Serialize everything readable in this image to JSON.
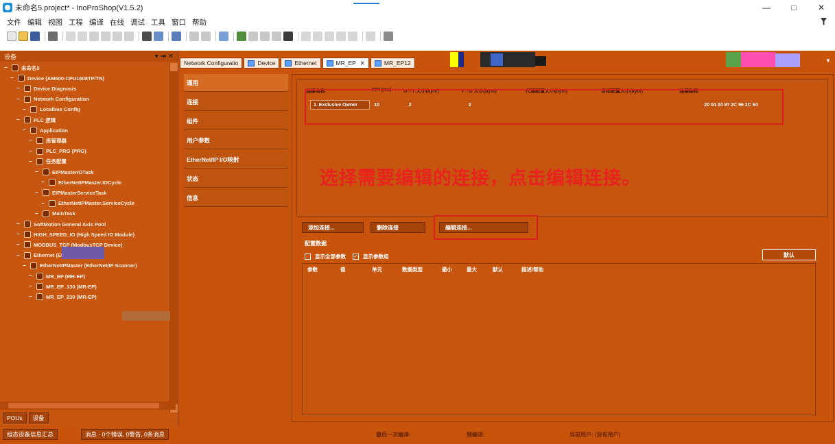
{
  "window": {
    "title": "未命名5.project* - InoProShop(V1.5.2)",
    "controls": [
      "—",
      "□",
      "✕"
    ]
  },
  "menu": [
    "文件",
    "编辑",
    "视图",
    "工程",
    "编译",
    "在线",
    "调试",
    "工具",
    "窗口",
    "帮助"
  ],
  "left_panel": {
    "title": "设备",
    "pin_controls": "▾ ⇥ ✕",
    "tree": [
      {
        "label": "未命名5",
        "indent": 0
      },
      {
        "label": "Device (AM600-CPU1608TP/TN)",
        "indent": 1
      },
      {
        "label": "Device Diagnosis",
        "indent": 2
      },
      {
        "label": "Network Configuration",
        "indent": 2
      },
      {
        "label": "Localbus Config",
        "indent": 3
      },
      {
        "label": "PLC 逻辑",
        "indent": 2
      },
      {
        "label": "Application",
        "indent": 3
      },
      {
        "label": "库管理器",
        "indent": 4
      },
      {
        "label": "PLC_PRG (PRG)",
        "indent": 4
      },
      {
        "label": "任务配置",
        "indent": 4
      },
      {
        "label": "EIPMasterIOTask",
        "indent": 5
      },
      {
        "label": "EtherNetIPMaster.IOCycle",
        "indent": 6
      },
      {
        "label": "EIPMasterServiceTask",
        "indent": 5
      },
      {
        "label": "EtherNetIPMaster.ServiceCycle",
        "indent": 6
      },
      {
        "label": "MainTask",
        "indent": 5
      },
      {
        "label": "SoftMotion General Axis Pool",
        "indent": 2
      },
      {
        "label": "HIGH_SPEED_IO (High Speed IO Module)",
        "indent": 2
      },
      {
        "label": "MODBUS_TCP (ModbusTCP Device)",
        "indent": 2
      },
      {
        "label": "Ethernet (Ethernet)",
        "indent": 2
      },
      {
        "label": "EtherNetIPMaster (EtherNet/IP Scanner)",
        "indent": 3
      },
      {
        "label": "MR_EP (MR-EP)",
        "indent": 4
      },
      {
        "label": "MR_EP_130 (MR-EP)",
        "indent": 4
      },
      {
        "label": "MR_EP_230 (MR-EP)",
        "indent": 4
      }
    ],
    "bottom_tabs": [
      "POUs",
      "设备"
    ]
  },
  "editor_tabs": [
    {
      "label": "Network Configuratio",
      "active": false
    },
    {
      "label": "Device",
      "active": false
    },
    {
      "label": "Ethernet",
      "active": false
    },
    {
      "label": "MR_EP",
      "active": true
    },
    {
      "label": "MR_EP12",
      "active": false
    }
  ],
  "editor_nav": [
    "通用",
    "连接",
    "组件",
    "用户参数",
    "EtherNet/IP I/O映射",
    "状态",
    "信息"
  ],
  "connections": {
    "headers": [
      "连接名称",
      "RPI (ms)",
      "O→T 大小(byte)",
      "T→O 大小(byte)",
      "代理配置大小(byte)",
      "目标配置大小(byte)",
      "连接路径"
    ],
    "row": {
      "name": "1. Exclusive Owner",
      "rpi": "10",
      "ot_size": "2",
      "to_size": "2",
      "path": "20 04 24 97 2C 96 2C 64"
    }
  },
  "instruction": "选择需要编辑的连接，点击编辑连接。",
  "actions": {
    "add": "添加连接...",
    "delete": "删除连接",
    "edit": "编辑连接..."
  },
  "config": {
    "label": "配置数据",
    "show_all": "显示全部参数",
    "show_params": "显示参数组",
    "default_button": "默认",
    "columns": [
      "参数",
      "值",
      "单元",
      "数据类型",
      "最小",
      "最大",
      "默认",
      "描述/帮助"
    ]
  },
  "bottom_tabs": [
    "组态设备信息汇总",
    "消息 - 0个错误, 0警告, 0条消息"
  ],
  "status": {
    "left": "最后一次编译:",
    "pre": "预编译:",
    "user": "当前用户: (没有用户)"
  },
  "colors": {
    "workspace": "#c8540c",
    "highlight_red": "#d8201e",
    "instruction_red": "#e8231e"
  }
}
